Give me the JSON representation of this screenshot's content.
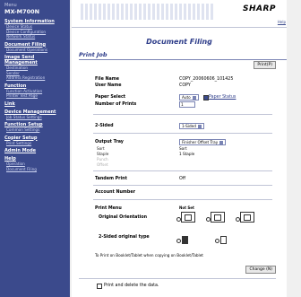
{
  "sidebar": {
    "model_small": "Menu",
    "model": "MX-M700N",
    "sections": [
      {
        "heading": "System Information",
        "links": [
          "Device Status",
          "Device Configuration",
          "Network Status"
        ]
      },
      {
        "heading": "Document Filing",
        "links": [
          "Document Operations"
        ]
      },
      {
        "heading": "Image Send Management",
        "links": [
          "Destination",
          "Sender",
          "Address Registration"
        ]
      },
      {
        "heading": "Function",
        "links": [
          "Function Activation",
          "Printer Test Page"
        ]
      },
      {
        "heading": "Link",
        "links": []
      },
      {
        "heading": "Device Management",
        "links": [
          "Job Status Settings"
        ]
      },
      {
        "heading": "Function Setup",
        "links": [
          "Common Settings"
        ]
      },
      {
        "heading": "Copier Setup",
        "links": [
          "Print Settings"
        ]
      },
      {
        "heading": "Admin Mode",
        "links": []
      },
      {
        "heading": "Help",
        "links": [
          "Operation",
          "Document Filing"
        ]
      }
    ]
  },
  "header": {
    "logo": "SHARP",
    "help": "Help"
  },
  "page_title": "Document Filing",
  "section_title": "Print Job",
  "print_button": "Print(P)",
  "fields": {
    "file_name": {
      "label": "File Name",
      "value": "COPY_20060606_101425"
    },
    "user_name": {
      "label": "User Name",
      "value": "COPY"
    },
    "paper_select": {
      "label": "Paper Select",
      "value": "Auto",
      "link": "Paper Status"
    },
    "num_prints": {
      "label": "Number of Prints",
      "value": "1"
    },
    "exposure": {
      "label": "2-Sided",
      "value": "1-Sided"
    },
    "output_tray": {
      "label": "Output Tray",
      "value": "Finisher Offset Tray"
    },
    "sort": {
      "label": "Sort",
      "value": "Sort"
    },
    "staple": {
      "label": "Staple",
      "value": "1 Staple"
    },
    "punch": {
      "label": "Punch"
    },
    "offset": {
      "label": "Offset"
    },
    "tandem": {
      "label": "Tandem Print",
      "value": "Off"
    },
    "account": {
      "label": "Account Number"
    }
  },
  "print_menu": {
    "label": "Print Menu",
    "col_label": "Not Set",
    "orientation_label": "Original Orientation",
    "original_type_label": "2-Sided original type",
    "note": "To Print on Booklet/Tablet when copying on Booklet/Tablet",
    "change_button": "Change (N)"
  },
  "footer_check": "Print and delete the data."
}
